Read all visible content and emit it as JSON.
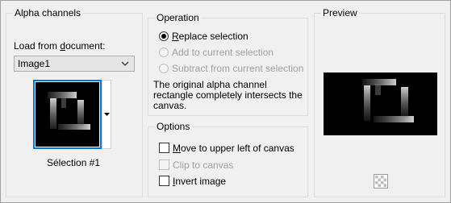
{
  "alpha": {
    "title": "Alpha channels",
    "load_label": "Load from document:",
    "document_value": "Image1",
    "selection_caption": "Sélection #1"
  },
  "operation": {
    "title": "Operation",
    "replace": "Replace selection",
    "add": "Add to current selection",
    "subtract": "Subtract from current selection",
    "info_line1": "The original alpha channel",
    "info_line2": "rectangle completely intersects the",
    "info_line3": "canvas."
  },
  "options": {
    "title": "Options",
    "move": "Move to upper left of canvas",
    "clip": "Clip to canvas",
    "invert": "Invert image"
  },
  "preview": {
    "title": "Preview"
  }
}
